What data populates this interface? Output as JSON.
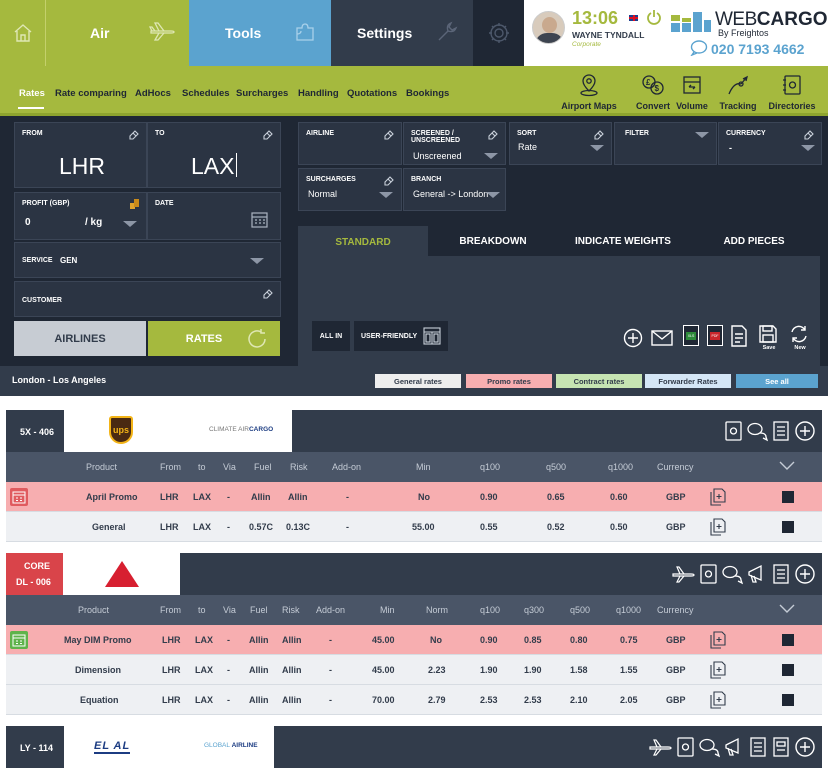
{
  "topbar": {
    "tabs": [
      {
        "label": "Air",
        "icon": "plane-icon"
      },
      {
        "label": "Tools",
        "icon": "puzzle-icon"
      },
      {
        "label": "Settings",
        "icon": "wrench-icon"
      }
    ],
    "time": "13:06",
    "user_name": "WAYNE TYNDALL",
    "user_role": "Corporate",
    "brand_name_a": "WEB",
    "brand_name_b": "CARGO",
    "brand_tm": "TM",
    "brand_sub": "By Freightos",
    "phone": "020 7193 4662"
  },
  "subnav": {
    "items": [
      "Rates",
      "Rate comparing",
      "AdHocs",
      "Schedules",
      "Surcharges",
      "Handling",
      "Quotations",
      "Bookings"
    ],
    "tools": [
      "Airport Maps",
      "Convert",
      "Volume",
      "Tracking",
      "Directories"
    ]
  },
  "form": {
    "from_label": "FROM",
    "from_value": "LHR",
    "to_label": "TO",
    "to_value": "LAX",
    "profit_label": "PROFIT (GBP)",
    "profit_value": "0",
    "profit_unit": "/ kg",
    "date_label": "DATE",
    "service_label": "SERVICE",
    "service_value": "GEN",
    "customer_label": "CUSTOMER",
    "airlines_button": "AIRLINES",
    "rates_button": "RATES",
    "airline_label": "AIRLINE",
    "screened_label_1": "SCREENED /",
    "screened_label_2": "UNSCREENED",
    "screened_value": "Unscreened",
    "sort_label": "SORT",
    "sort_value": "Rate",
    "filter_label": "FILTER",
    "currency_label": "CURRENCY",
    "currency_value": "-",
    "surcharges_label": "SURCHARGES",
    "surcharges_value": "Normal",
    "branch_label": "BRANCH",
    "branch_value": "General -> London",
    "tabs": [
      "STANDARD",
      "BREAKDOWN",
      "INDICATE WEIGHTS",
      "ADD PIECES"
    ],
    "allin_button": "ALL IN",
    "userfriendly_button": "USER-FRIENDLY",
    "save_label": "Save",
    "new_label": "New",
    "xls_label": "XLS",
    "pdf_label": "PDF"
  },
  "route": {
    "title": "London - Los Angeles",
    "legend": [
      "General rates",
      "Promo rates",
      "Contract rates",
      "Forwarder Rates",
      "See all"
    ],
    "colors": {
      "general": "#eeeeee",
      "promo": "#f7aeb0",
      "contract": "#c6e4b2",
      "forwarder": "#d4e6f6",
      "seeall": "#5ba3cf"
    }
  },
  "carriers": [
    {
      "code": "5X - 406",
      "logo_text": "ups",
      "alliance_prefix": "CLIMATE AIR",
      "alliance": "CARGO",
      "columns": [
        "Product",
        "From",
        "to",
        "Via",
        "Fuel",
        "Risk",
        "Add-on",
        "Min",
        "q100",
        "q500",
        "q1000",
        "Currency"
      ],
      "rows": [
        {
          "type": "promo",
          "cells": [
            "April Promo",
            "LHR",
            "LAX",
            "-",
            "Allin",
            "Allin",
            "-",
            "No",
            "0.90",
            "0.65",
            "0.60",
            "GBP"
          ]
        },
        {
          "type": "general",
          "cells": [
            "General",
            "LHR",
            "LAX",
            "-",
            "0.57C",
            "0.13C",
            "-",
            "55.00",
            "0.55",
            "0.52",
            "0.50",
            "GBP"
          ]
        }
      ]
    },
    {
      "code_top": "CORE",
      "code": "DL - 006",
      "columns": [
        "Product",
        "From",
        "to",
        "Via",
        "Fuel",
        "Risk",
        "Add-on",
        "Min",
        "Norm",
        "q100",
        "q300",
        "q500",
        "q1000",
        "Currency"
      ],
      "rows": [
        {
          "type": "promo",
          "cells": [
            "May DIM Promo",
            "LHR",
            "LAX",
            "-",
            "Allin",
            "Allin",
            "-",
            "45.00",
            "No",
            "0.90",
            "0.85",
            "0.80",
            "0.75",
            "GBP"
          ]
        },
        {
          "type": "general",
          "cells": [
            "Dimension",
            "LHR",
            "LAX",
            "-",
            "Allin",
            "Allin",
            "-",
            "45.00",
            "2.23",
            "1.90",
            "1.90",
            "1.58",
            "1.55",
            "GBP"
          ]
        },
        {
          "type": "general",
          "cells": [
            "Equation",
            "LHR",
            "LAX",
            "-",
            "Allin",
            "Allin",
            "-",
            "70.00",
            "2.79",
            "2.53",
            "2.53",
            "2.10",
            "2.05",
            "GBP"
          ]
        }
      ]
    },
    {
      "code": "LY - 114",
      "logo_text": "EL AL",
      "alliance_prefix": "GLOBAL ",
      "alliance": "AIRLINE"
    }
  ]
}
